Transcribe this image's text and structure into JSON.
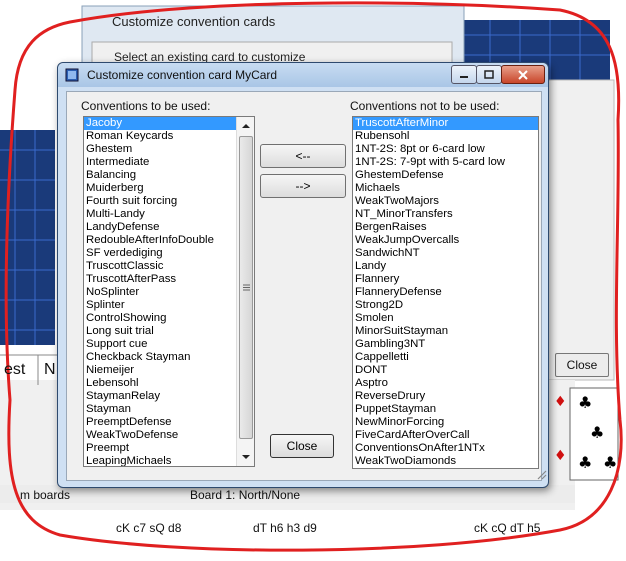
{
  "background": {
    "window_title": "Customize convention cards",
    "window_subtitle": "Select an existing card to customize",
    "close_button": "Close",
    "status_left": "m boards",
    "status_board": "Board 1: North/None",
    "seat_label_1": "est",
    "seat_label_2": "N",
    "cards_1": "cK  c7  sQ  d8",
    "cards_2": "dT  h6  h3  d9",
    "cards_3": "cK  cQ  dT  h5",
    "accent_red": "#e02020"
  },
  "dialog": {
    "title": "Customize convention card MyCard",
    "left_label": "Conventions to be used:",
    "right_label": "Conventions not to be used:",
    "add_button": "<--",
    "remove_button": "-->",
    "close_button": "Close",
    "left_items": [
      "Jacoby",
      "Roman Keycards",
      "Ghestem",
      "Intermediate",
      "Balancing",
      "Muiderberg",
      "Fourth suit forcing",
      "Multi-Landy",
      "LandyDefense",
      "RedoubleAfterInfoDouble",
      "SF verdediging",
      "TruscottClassic",
      "TruscottAfterPass",
      "NoSplinter",
      "Splinter",
      "ControlShowing",
      "Long suit trial",
      "Support cue",
      "Checkback Stayman",
      "Niemeijer",
      "Lebensohl",
      "StaymanRelay",
      "Stayman",
      "PreemptDefense",
      "WeakTwoDefense",
      "Preempt",
      "LeapingMichaels"
    ],
    "left_selected": "Jacoby",
    "right_items": [
      "TruscottAfterMinor",
      "Rubensohl",
      "1NT-2S: 8pt or 6-card low",
      "1NT-2S: 7-9pt with 5-card low",
      "GhestemDefense",
      "Michaels",
      "WeakTwoMajors",
      "NT_MinorTransfers",
      "BergenRaises",
      "WeakJumpOvercalls",
      "SandwichNT",
      "Landy",
      "Flannery",
      "FlanneryDefense",
      "Strong2D",
      "Smolen",
      "MinorSuitStayman",
      "Gambling3NT",
      "Cappelletti",
      "DONT",
      "Asptro",
      "ReverseDrury",
      "PuppetStayman",
      "NewMinorForcing",
      "FiveCardAfterOverCall",
      "ConventionsOnAfter1NTx",
      "WeakTwoDiamonds"
    ],
    "right_selected": "TruscottAfterMinor",
    "selection_color": "#3399ff"
  }
}
